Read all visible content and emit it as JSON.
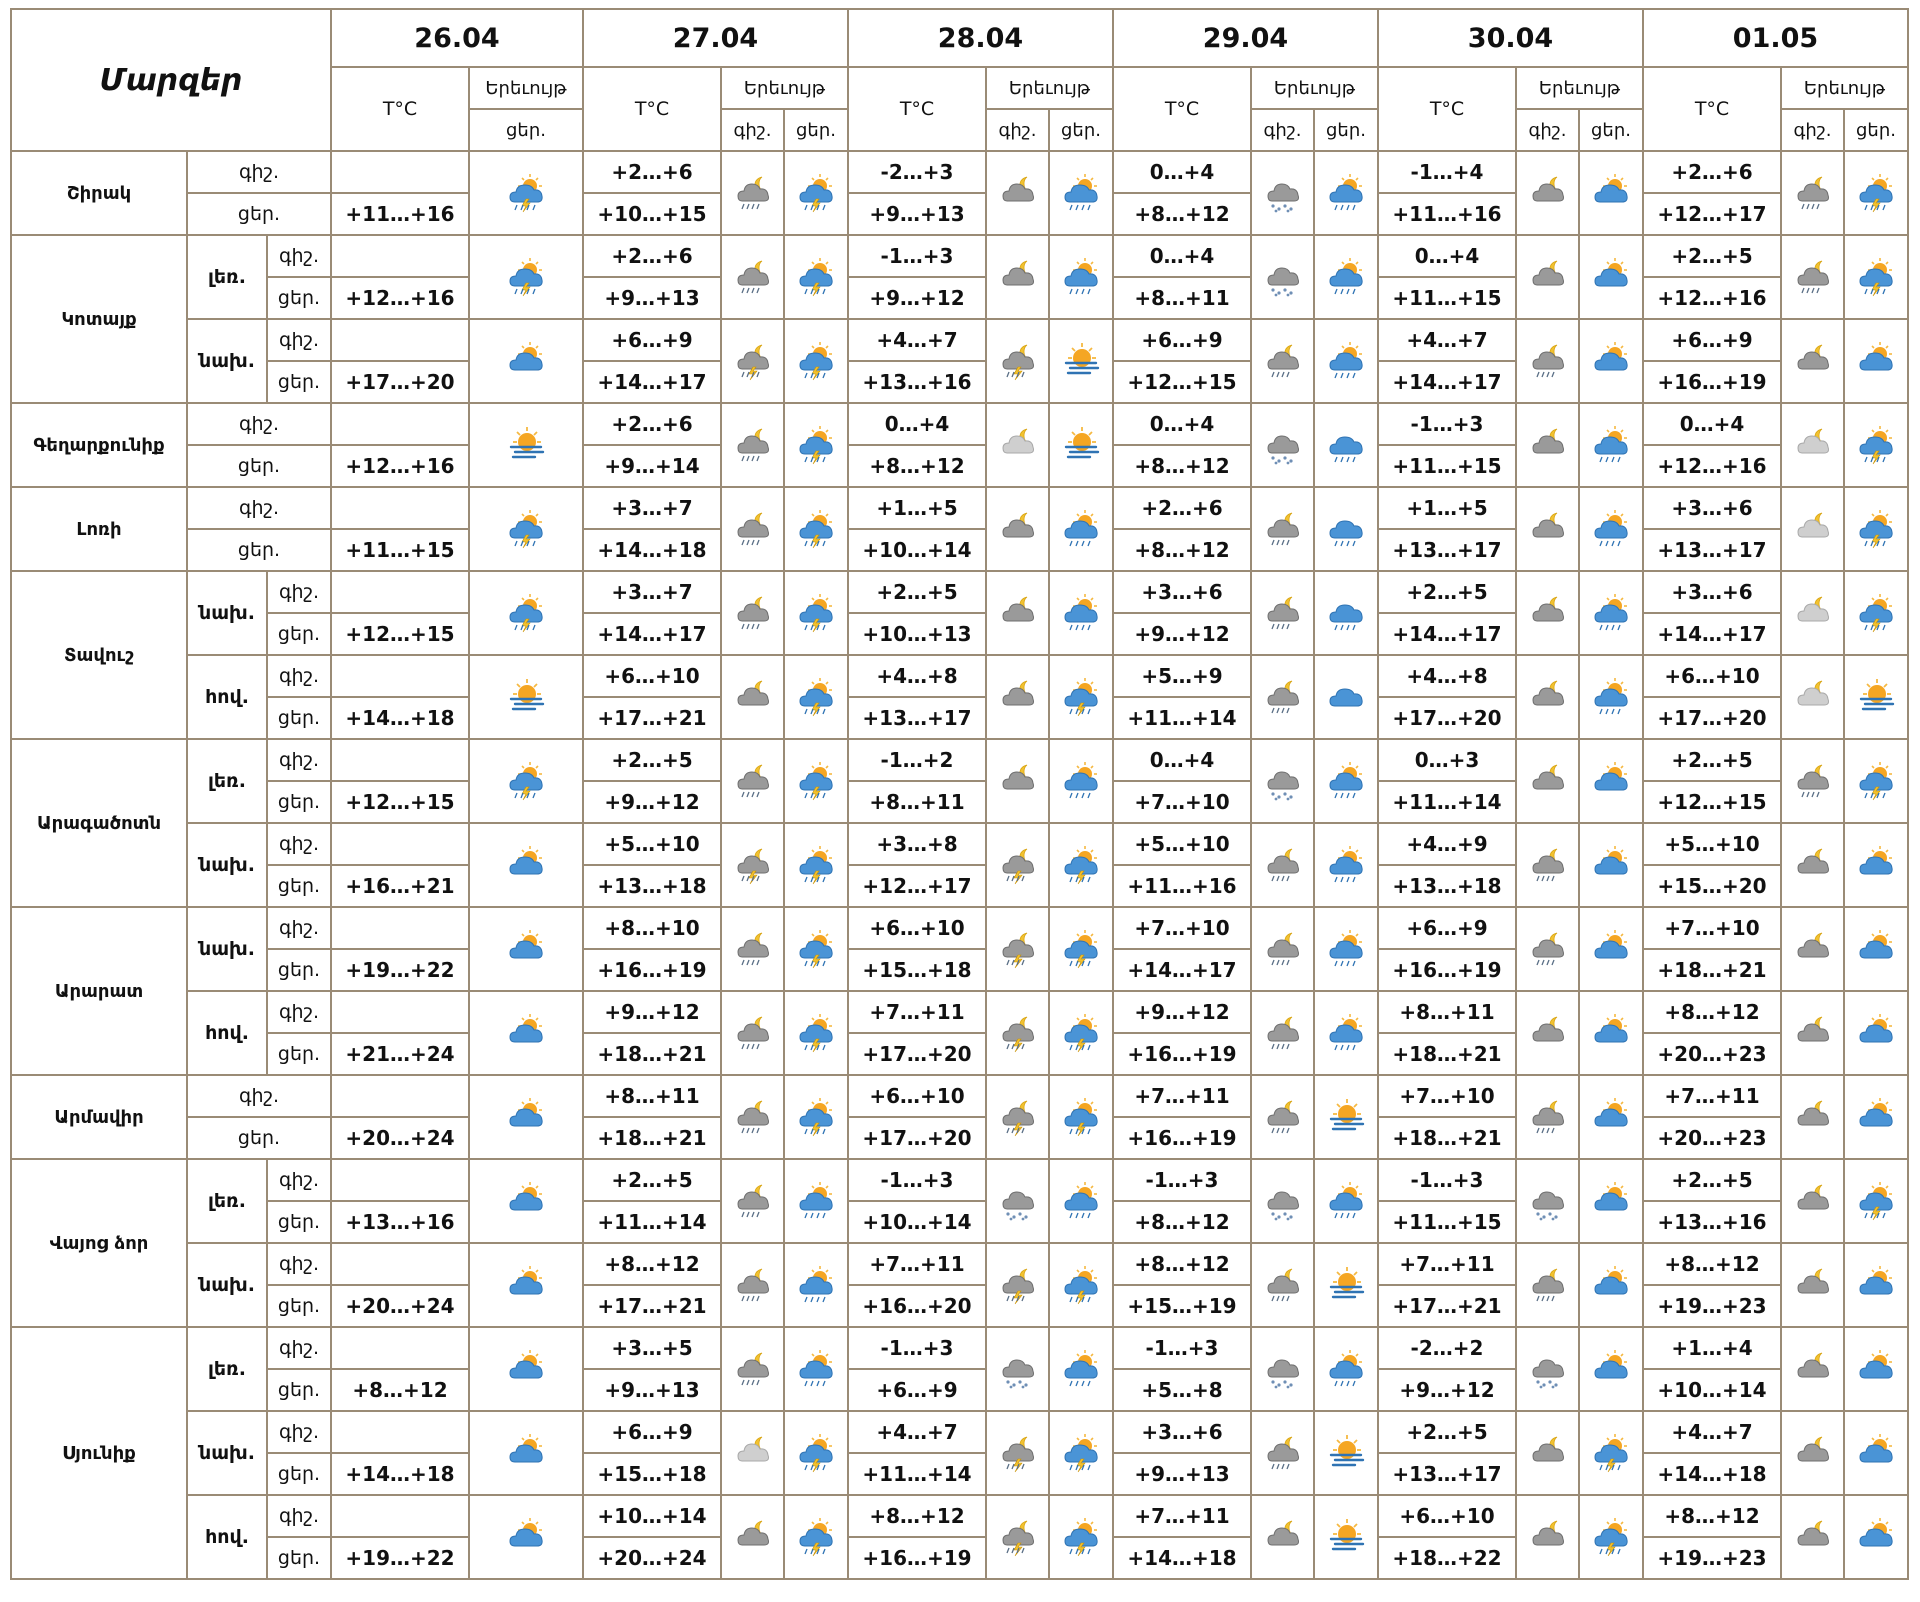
{
  "header": {
    "title": "Մարզեր",
    "temp_label": "T°C",
    "events_label": "Երեւույթ",
    "night": "գիշ.",
    "day": "ցեր.",
    "dates": [
      "26.04",
      "27.04",
      "28.04",
      "29.04",
      "30.04",
      "01.05"
    ]
  },
  "regions": [
    {
      "name": "Շիրակ",
      "zones": [
        {
          "label": "",
          "night": [
            "",
            "+2…+6",
            "-2…+3",
            "0…+4",
            "-1…+4",
            "+2…+6"
          ],
          "day": [
            "+11…+16",
            "+10…+15",
            "+9…+13",
            "+8…+12",
            "+11…+16",
            "+12…+17"
          ],
          "icons": [
            [
              "sun-cloud-lightning-icon"
            ],
            [
              "moon-cloud-rain-icon",
              "sun-cloud-lightning-icon"
            ],
            [
              "moon-cloud-icon",
              "sun-cloud-rain-icon"
            ],
            [
              "cloud-snow-icon",
              "sun-cloud-rain-icon"
            ],
            [
              "moon-cloud-icon",
              "sun-cloud-icon"
            ],
            [
              "moon-cloud-rain-icon",
              "sun-cloud-lightning-icon"
            ]
          ]
        }
      ]
    },
    {
      "name": "Կոտայք",
      "zones": [
        {
          "label": "լեռ.",
          "night": [
            "",
            "+2…+6",
            "-1…+3",
            "0…+4",
            "0…+4",
            "+2…+5"
          ],
          "day": [
            "+12…+16",
            "+9…+13",
            "+9…+12",
            "+8…+11",
            "+11…+15",
            "+12…+16"
          ],
          "icons": [
            [
              "sun-cloud-lightning-icon"
            ],
            [
              "moon-cloud-rain-icon",
              "sun-cloud-lightning-icon"
            ],
            [
              "moon-cloud-icon",
              "sun-cloud-rain-icon"
            ],
            [
              "cloud-snow-icon",
              "sun-cloud-rain-icon"
            ],
            [
              "moon-cloud-icon",
              "sun-cloud-icon"
            ],
            [
              "moon-cloud-rain-icon",
              "sun-cloud-lightning-icon"
            ]
          ]
        },
        {
          "label": "նախ.",
          "night": [
            "",
            "+6…+9",
            "+4…+7",
            "+6…+9",
            "+4…+7",
            "+6…+9"
          ],
          "day": [
            "+17…+20",
            "+14…+17",
            "+13…+16",
            "+12…+15",
            "+14…+17",
            "+16…+19"
          ],
          "icons": [
            [
              "sun-cloud-icon"
            ],
            [
              "moon-cloud-lightning-icon",
              "sun-cloud-storm-icon"
            ],
            [
              "moon-cloud-lightning-icon",
              "sun-fog-icon"
            ],
            [
              "moon-cloud-rain-icon",
              "sun-cloud-rain-icon"
            ],
            [
              "moon-cloud-rain-icon",
              "sun-cloud-icon"
            ],
            [
              "moon-cloud-icon",
              "sun-cloud-icon"
            ]
          ]
        }
      ]
    },
    {
      "name": "Գեղարքունիք",
      "zones": [
        {
          "label": "",
          "night": [
            "",
            "+2…+6",
            "0…+4",
            "0…+4",
            "-1…+3",
            "0…+4"
          ],
          "day": [
            "+12…+16",
            "+9…+14",
            "+8…+12",
            "+8…+12",
            "+11…+15",
            "+12…+16"
          ],
          "icons": [
            [
              "sun-fog-icon"
            ],
            [
              "moon-cloud-rain-icon",
              "sun-cloud-lightning-icon"
            ],
            [
              "moon-light-cloud-icon",
              "sun-fog-icon"
            ],
            [
              "cloud-snow-icon",
              "cloud-rain-icon"
            ],
            [
              "moon-cloud-icon",
              "sun-cloud-rain-icon"
            ],
            [
              "moon-light-cloud-icon",
              "sun-cloud-lightning-icon"
            ]
          ]
        }
      ]
    },
    {
      "name": "Լոռի",
      "zones": [
        {
          "label": "",
          "night": [
            "",
            "+3…+7",
            "+1…+5",
            "+2…+6",
            "+1…+5",
            "+3…+6"
          ],
          "day": [
            "+11…+15",
            "+14…+18",
            "+10…+14",
            "+8…+12",
            "+13…+17",
            "+13…+17"
          ],
          "icons": [
            [
              "sun-cloud-lightning-icon"
            ],
            [
              "moon-cloud-rain-icon",
              "sun-cloud-storm-icon"
            ],
            [
              "moon-cloud-icon",
              "sun-cloud-rain-icon"
            ],
            [
              "moon-cloud-rain-icon",
              "cloud-rain-icon"
            ],
            [
              "moon-cloud-icon",
              "sun-cloud-rain-icon"
            ],
            [
              "moon-light-cloud-icon",
              "sun-cloud-lightning-icon"
            ]
          ]
        }
      ]
    },
    {
      "name": "Տավուշ",
      "zones": [
        {
          "label": "նախ.",
          "night": [
            "",
            "+3…+7",
            "+2…+5",
            "+3…+6",
            "+2…+5",
            "+3…+6"
          ],
          "day": [
            "+12…+15",
            "+14…+17",
            "+10…+13",
            "+9…+12",
            "+14…+17",
            "+14…+17"
          ],
          "icons": [
            [
              "sun-cloud-lightning-icon"
            ],
            [
              "moon-cloud-rain-icon",
              "sun-cloud-storm-icon"
            ],
            [
              "moon-cloud-icon",
              "sun-cloud-rain-icon"
            ],
            [
              "moon-cloud-rain-icon",
              "cloud-rain-icon"
            ],
            [
              "moon-cloud-icon",
              "sun-cloud-rain-icon"
            ],
            [
              "moon-light-cloud-icon",
              "sun-cloud-lightning-icon"
            ]
          ]
        },
        {
          "label": "հով.",
          "night": [
            "",
            "+6…+10",
            "+4…+8",
            "+5…+9",
            "+4…+8",
            "+6…+10"
          ],
          "day": [
            "+14…+18",
            "+17…+21",
            "+13…+17",
            "+11…+14",
            "+17…+20",
            "+17…+20"
          ],
          "icons": [
            [
              "sun-fog-icon"
            ],
            [
              "moon-cloud-icon",
              "sun-cloud-lightning-icon"
            ],
            [
              "moon-cloud-icon",
              "sun-cloud-lightning-icon"
            ],
            [
              "moon-cloud-rain-icon",
              "cloud-icon"
            ],
            [
              "moon-cloud-icon",
              "sun-cloud-rain-icon"
            ],
            [
              "moon-light-cloud-icon",
              "sun-fog-icon"
            ]
          ]
        }
      ]
    },
    {
      "name": "Արագածոտն",
      "zones": [
        {
          "label": "լեռ.",
          "night": [
            "",
            "+2…+5",
            "-1…+2",
            "0…+4",
            "0…+3",
            "+2…+5"
          ],
          "day": [
            "+12…+15",
            "+9…+12",
            "+8…+11",
            "+7…+10",
            "+11…+14",
            "+12…+15"
          ],
          "icons": [
            [
              "sun-cloud-lightning-icon"
            ],
            [
              "moon-cloud-rain-icon",
              "sun-cloud-lightning-icon"
            ],
            [
              "moon-cloud-icon",
              "sun-cloud-rain-icon"
            ],
            [
              "cloud-snow-icon",
              "sun-cloud-rain-icon"
            ],
            [
              "moon-cloud-icon",
              "sun-cloud-icon"
            ],
            [
              "moon-cloud-rain-icon",
              "sun-cloud-lightning-icon"
            ]
          ]
        },
        {
          "label": "նախ.",
          "night": [
            "",
            "+5…+10",
            "+3…+8",
            "+5…+10",
            "+4…+9",
            "+5…+10"
          ],
          "day": [
            "+16…+21",
            "+13…+18",
            "+12…+17",
            "+11…+16",
            "+13…+18",
            "+15…+20"
          ],
          "icons": [
            [
              "sun-cloud-icon"
            ],
            [
              "moon-cloud-lightning-icon",
              "sun-cloud-storm-icon"
            ],
            [
              "moon-cloud-lightning-icon",
              "sun-cloud-lightning-icon"
            ],
            [
              "moon-cloud-rain-icon",
              "sun-cloud-rain-icon"
            ],
            [
              "moon-cloud-rain-icon",
              "sun-cloud-icon"
            ],
            [
              "moon-cloud-icon",
              "sun-cloud-icon"
            ]
          ]
        }
      ]
    },
    {
      "name": "Արարատ",
      "zones": [
        {
          "label": "նախ.",
          "night": [
            "",
            "+8…+10",
            "+6…+10",
            "+7…+10",
            "+6…+9",
            "+7…+10"
          ],
          "day": [
            "+19…+22",
            "+16…+19",
            "+15…+18",
            "+14…+17",
            "+16…+19",
            "+18…+21"
          ],
          "icons": [
            [
              "sun-cloud-icon"
            ],
            [
              "moon-cloud-rain-icon",
              "sun-cloud-lightning-icon"
            ],
            [
              "moon-cloud-lightning-icon",
              "sun-cloud-lightning-icon"
            ],
            [
              "moon-cloud-rain-icon",
              "sun-cloud-rain-icon"
            ],
            [
              "moon-cloud-rain-icon",
              "sun-cloud-icon"
            ],
            [
              "moon-cloud-icon",
              "sun-cloud-icon"
            ]
          ]
        },
        {
          "label": "հով.",
          "night": [
            "",
            "+9…+12",
            "+7…+11",
            "+9…+12",
            "+8…+11",
            "+8…+12"
          ],
          "day": [
            "+21…+24",
            "+18…+21",
            "+17…+20",
            "+16…+19",
            "+18…+21",
            "+20…+23"
          ],
          "icons": [
            [
              "sun-cloud-icon"
            ],
            [
              "moon-cloud-rain-icon",
              "sun-cloud-lightning-icon"
            ],
            [
              "moon-cloud-lightning-icon",
              "sun-cloud-lightning-icon"
            ],
            [
              "moon-cloud-rain-icon",
              "sun-cloud-rain-icon"
            ],
            [
              "moon-cloud-icon",
              "sun-cloud-icon"
            ],
            [
              "moon-cloud-icon",
              "sun-cloud-icon"
            ]
          ]
        }
      ]
    },
    {
      "name": "Արմավիր",
      "zones": [
        {
          "label": "",
          "night": [
            "",
            "+8…+11",
            "+6…+10",
            "+7…+11",
            "+7…+10",
            "+7…+11"
          ],
          "day": [
            "+20…+24",
            "+18…+21",
            "+17…+20",
            "+16…+19",
            "+18…+21",
            "+20…+23"
          ],
          "icons": [
            [
              "sun-cloud-icon"
            ],
            [
              "moon-cloud-rain-icon",
              "sun-cloud-lightning-icon"
            ],
            [
              "moon-cloud-lightning-icon",
              "sun-cloud-lightning-icon"
            ],
            [
              "moon-cloud-rain-icon",
              "sun-fog-icon"
            ],
            [
              "moon-cloud-rain-icon",
              "sun-cloud-icon"
            ],
            [
              "moon-cloud-icon",
              "sun-cloud-icon"
            ]
          ]
        }
      ]
    },
    {
      "name": "Վայոց ձոր",
      "zones": [
        {
          "label": "լեռ.",
          "night": [
            "",
            "+2…+5",
            "-1…+3",
            "-1…+3",
            "-1…+3",
            "+2…+5"
          ],
          "day": [
            "+13…+16",
            "+11…+14",
            "+10…+14",
            "+8…+12",
            "+11…+15",
            "+13…+16"
          ],
          "icons": [
            [
              "sun-cloud-icon"
            ],
            [
              "moon-cloud-rain-icon",
              "sun-cloud-rain-icon"
            ],
            [
              "cloud-snow-icon",
              "sun-cloud-rain-icon"
            ],
            [
              "cloud-snow-icon",
              "sun-cloud-rain-icon"
            ],
            [
              "cloud-snow-icon",
              "sun-cloud-icon"
            ],
            [
              "moon-cloud-icon",
              "sun-cloud-lightning-icon"
            ]
          ]
        },
        {
          "label": "նախ.",
          "night": [
            "",
            "+8…+12",
            "+7…+11",
            "+8…+12",
            "+7…+11",
            "+8…+12"
          ],
          "day": [
            "+20…+24",
            "+17…+21",
            "+16…+20",
            "+15…+19",
            "+17…+21",
            "+19…+23"
          ],
          "icons": [
            [
              "sun-cloud-icon"
            ],
            [
              "moon-cloud-rain-icon",
              "sun-cloud-rain-icon"
            ],
            [
              "moon-cloud-lightning-icon",
              "sun-cloud-lightning-icon"
            ],
            [
              "moon-cloud-rain-icon",
              "sun-fog-icon"
            ],
            [
              "moon-cloud-rain-icon",
              "sun-cloud-icon"
            ],
            [
              "moon-cloud-icon",
              "sun-cloud-icon"
            ]
          ]
        }
      ]
    },
    {
      "name": "Սյունիք",
      "zones": [
        {
          "label": "լեռ.",
          "night": [
            "",
            "+3…+5",
            "-1…+3",
            "-1…+3",
            "-2…+2",
            "+1…+4"
          ],
          "day": [
            "+8…+12",
            "+9…+13",
            "+6…+9",
            "+5…+8",
            "+9…+12",
            "+10…+14"
          ],
          "icons": [
            [
              "sun-cloud-icon"
            ],
            [
              "moon-cloud-rain-icon",
              "sun-cloud-rain-icon"
            ],
            [
              "cloud-snow-icon",
              "sun-cloud-rain-icon"
            ],
            [
              "cloud-snow-icon",
              "sun-cloud-rain-icon"
            ],
            [
              "cloud-snow-icon",
              "sun-cloud-icon"
            ],
            [
              "moon-cloud-icon",
              "sun-cloud-icon"
            ]
          ]
        },
        {
          "label": "նախ.",
          "night": [
            "",
            "+6…+9",
            "+4…+7",
            "+3…+6",
            "+2…+5",
            "+4…+7"
          ],
          "day": [
            "+14…+18",
            "+15…+18",
            "+11…+14",
            "+9…+13",
            "+13…+17",
            "+14…+18"
          ],
          "icons": [
            [
              "sun-cloud-icon"
            ],
            [
              "moon-light-cloud-icon",
              "sun-cloud-lightning-icon"
            ],
            [
              "moon-cloud-lightning-icon",
              "sun-cloud-lightning-icon"
            ],
            [
              "moon-cloud-rain-icon",
              "sun-fog-icon"
            ],
            [
              "moon-cloud-icon",
              "sun-cloud-lightning-icon"
            ],
            [
              "moon-cloud-icon",
              "sun-cloud-icon"
            ]
          ]
        },
        {
          "label": "հով.",
          "night": [
            "",
            "+10…+14",
            "+8…+12",
            "+7…+11",
            "+6…+10",
            "+8…+12"
          ],
          "day": [
            "+19…+22",
            "+20…+24",
            "+16…+19",
            "+14…+18",
            "+18…+22",
            "+19…+23"
          ],
          "icons": [
            [
              "sun-cloud-icon"
            ],
            [
              "moon-cloud-icon",
              "sun-cloud-lightning-icon"
            ],
            [
              "moon-cloud-lightning-icon",
              "sun-cloud-lightning-icon"
            ],
            [
              "moon-cloud-icon",
              "sun-fog-icon"
            ],
            [
              "moon-cloud-icon",
              "sun-cloud-lightning-icon"
            ],
            [
              "moon-cloud-icon",
              "sun-cloud-icon"
            ]
          ]
        }
      ]
    }
  ]
}
